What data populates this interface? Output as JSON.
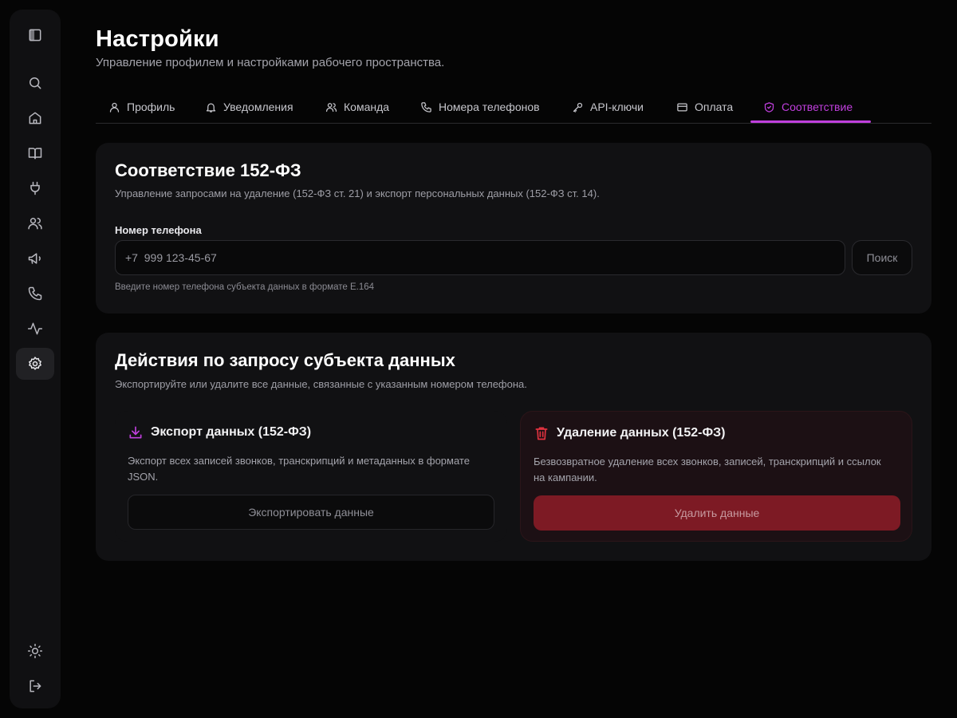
{
  "page": {
    "title": "Настройки",
    "subtitle": "Управление профилем и настройками рабочего пространства."
  },
  "sidebar": {
    "items": [
      {
        "icon": "sidebar-toggle-icon"
      },
      {
        "icon": "search-icon"
      },
      {
        "icon": "home-icon"
      },
      {
        "icon": "book-icon"
      },
      {
        "icon": "plug-icon"
      },
      {
        "icon": "users-icon"
      },
      {
        "icon": "megaphone-icon"
      },
      {
        "icon": "phone-icon"
      },
      {
        "icon": "activity-icon"
      },
      {
        "icon": "settings-icon",
        "active": true
      },
      {
        "icon": "sun-icon"
      },
      {
        "icon": "logout-icon"
      }
    ]
  },
  "tabs": [
    {
      "label": "Профиль",
      "icon": "user-icon"
    },
    {
      "label": "Уведомления",
      "icon": "bell-icon"
    },
    {
      "label": "Команда",
      "icon": "users-icon"
    },
    {
      "label": "Номера телефонов",
      "icon": "phone-icon"
    },
    {
      "label": "API-ключи",
      "icon": "key-icon"
    },
    {
      "label": "Оплата",
      "icon": "credit-card-icon"
    },
    {
      "label": "Соответствие",
      "icon": "shield-icon",
      "active": true
    }
  ],
  "compliance": {
    "title": "Соответствие 152-ФЗ",
    "description": "Управление запросами на удаление (152-ФЗ ст. 21) и экспорт персональных данных (152-ФЗ ст. 14).",
    "phone_label": "Номер телефона",
    "phone_placeholder": "+7  999 123-45-67",
    "search_label": "Поиск",
    "hint": "Введите номер телефона субъекта данных в формате E.164"
  },
  "actions": {
    "title": "Действия по запросу субъекта данных",
    "description": "Экспортируйте или удалите все данные, связанные с указанным номером телефона.",
    "export": {
      "title": "Экспорт данных (152-ФЗ)",
      "text": "Экспорт всех записей звонков, транскрипций и метаданных в формате JSON.",
      "button": "Экспортировать данные"
    },
    "delete": {
      "title": "Удаление данных (152-ФЗ)",
      "text": "Безвозвратное удаление всех звонков, записей, транскрипций и ссылок на кампании.",
      "button": "Удалить данные"
    }
  },
  "colors": {
    "accent": "#c03fdd",
    "danger": "#7d1a24",
    "danger_icon": "#e0323f",
    "background": "#050505",
    "card": "#111113"
  }
}
